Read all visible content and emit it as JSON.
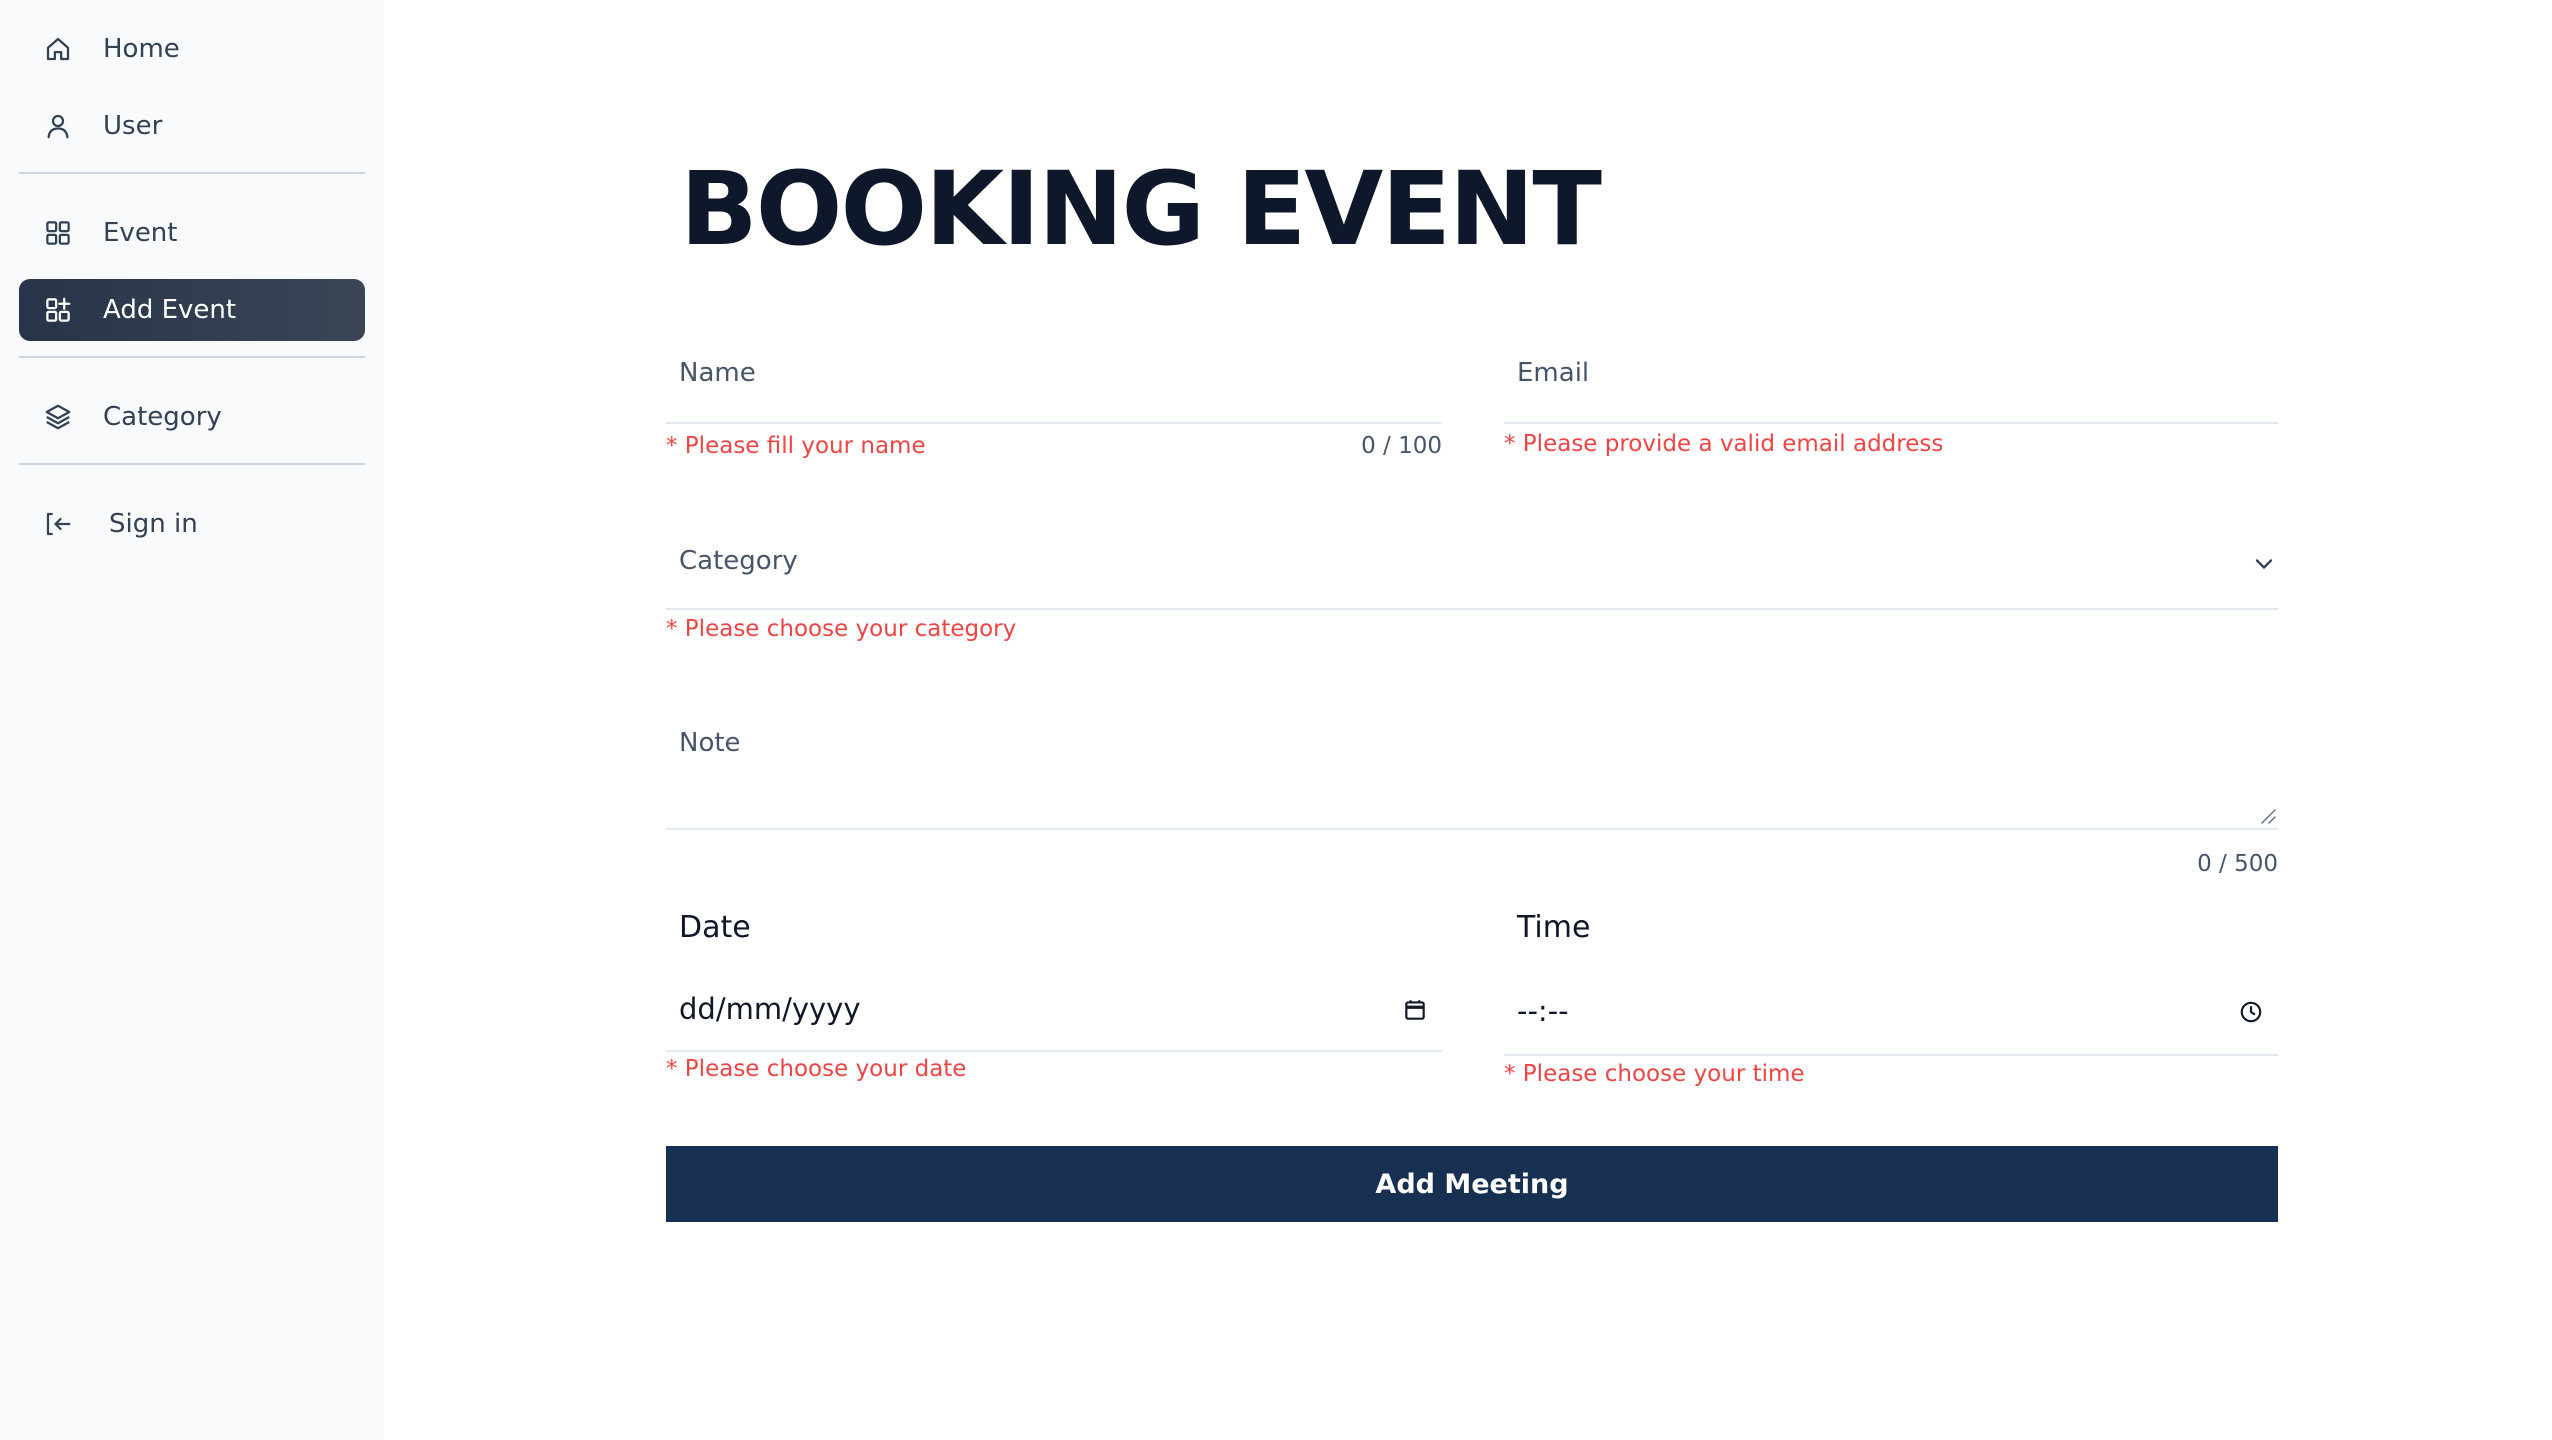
{
  "sidebar": {
    "items": [
      {
        "label": "Home",
        "icon": "home-icon"
      },
      {
        "label": "User",
        "icon": "user-icon"
      },
      {
        "label": "Event",
        "icon": "grid-icon"
      },
      {
        "label": "Add Event",
        "icon": "grid-plus-icon",
        "active": true
      },
      {
        "label": "Category",
        "icon": "layers-icon"
      },
      {
        "label": "Sign in",
        "icon": "sign-in-icon"
      }
    ]
  },
  "page": {
    "title": "BOOKING EVENT"
  },
  "form": {
    "name": {
      "label": "Name",
      "error": "* Please fill your name",
      "counter": "0 / 100"
    },
    "email": {
      "label": "Email",
      "error": "* Please provide a valid email address"
    },
    "category": {
      "label": "Category",
      "error": "* Please choose your category",
      "icon": "chevron-down-icon"
    },
    "note": {
      "label": "Note",
      "counter": "0 / 500"
    },
    "date": {
      "label": "Date",
      "value": "dd/mm/yyyy",
      "error": "* Please choose your date",
      "icon": "calendar-icon"
    },
    "time": {
      "label": "Time",
      "value": "--:--",
      "error": "* Please choose your time",
      "icon": "clock-icon"
    },
    "submit_label": "Add Meeting"
  },
  "colors": {
    "sidebar_bg": "#f8fafc",
    "active_item_bg": "#334155",
    "error": "#ef4444",
    "submit_bg": "#172f50",
    "title": "#0f172a"
  }
}
